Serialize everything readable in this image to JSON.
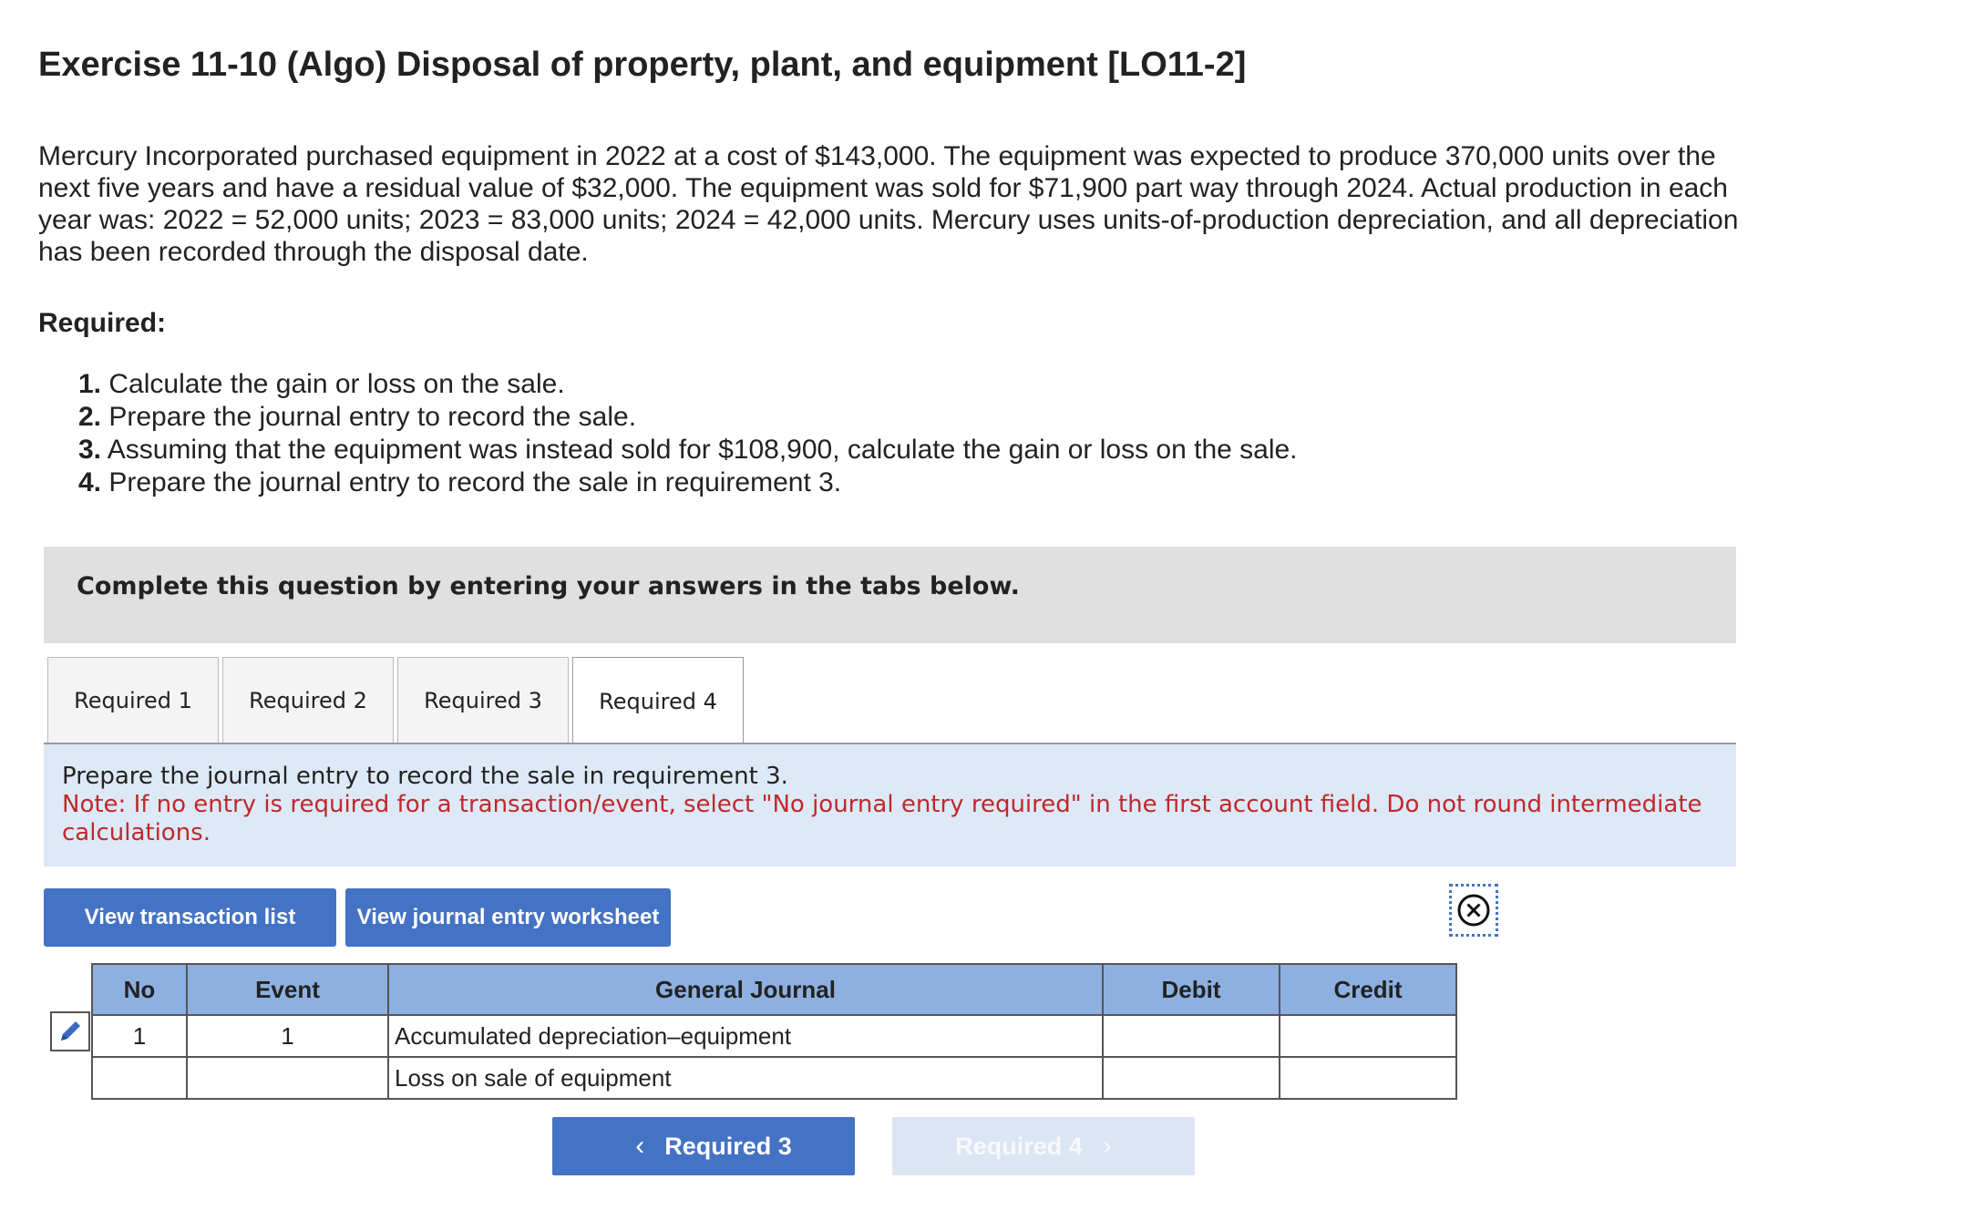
{
  "exercise": {
    "title": "Exercise 11-10 (Algo) Disposal of property, plant, and equipment [LO11-2]",
    "problem_text": "Mercury Incorporated purchased equipment in 2022 at a cost of $143,000. The equipment was expected to produce 370,000 units over the next five years and have a residual value of $32,000. The equipment was sold for $71,900 part way through 2024. Actual production in each year was: 2022 = 52,000 units; 2023 = 83,000 units; 2024 = 42,000 units. Mercury uses units-of-production depreciation, and all depreciation has been recorded through the disposal date.",
    "required_heading": "Required:",
    "requirements": [
      {
        "num": "1.",
        "text": " Calculate the gain or loss on the sale."
      },
      {
        "num": "2.",
        "text": " Prepare the journal entry to record the sale."
      },
      {
        "num": "3.",
        "text": " Assuming that the equipment was instead sold for $108,900, calculate the gain or loss on the sale."
      },
      {
        "num": "4.",
        "text": " Prepare the journal entry to record the sale in requirement 3."
      }
    ]
  },
  "complete_box": {
    "text": "Complete this question by entering your answers in the tabs below."
  },
  "tabs": [
    {
      "label": "Required 1",
      "active": false
    },
    {
      "label": "Required 2",
      "active": false
    },
    {
      "label": "Required 3",
      "active": false
    },
    {
      "label": "Required 4",
      "active": true
    }
  ],
  "instruction": {
    "main": "Prepare the journal entry to record the sale in requirement 3.",
    "note": "Note: If no entry is required for a transaction/event, select \"No journal entry required\" in the first account field. Do not round intermediate calculations."
  },
  "buttons": {
    "view_transaction_list": "View transaction list",
    "view_journal_worksheet": "View journal entry worksheet"
  },
  "journal": {
    "headers": {
      "no": "No",
      "event": "Event",
      "general_journal": "General Journal",
      "debit": "Debit",
      "credit": "Credit"
    },
    "rows": [
      {
        "no": "1",
        "event": "1",
        "account": "Accumulated depreciation–equipment",
        "debit": "",
        "credit": ""
      },
      {
        "no": "",
        "event": "",
        "account": "Loss on sale of equipment",
        "debit": "",
        "credit": ""
      }
    ]
  },
  "navigation": {
    "prev_label": "Required 3",
    "next_label": "Required 4",
    "next_disabled": true
  },
  "icons": {
    "close": "close-circle-icon",
    "edit": "pencil-icon",
    "prev": "chevron-left-icon",
    "next": "chevron-right-icon"
  },
  "colors": {
    "button_blue": "#4472c4",
    "table_header_blue": "#8db0e0",
    "instruction_bg": "#dde9f6",
    "note_red": "#c0282c",
    "disabled_button": "#dbe5f3"
  }
}
